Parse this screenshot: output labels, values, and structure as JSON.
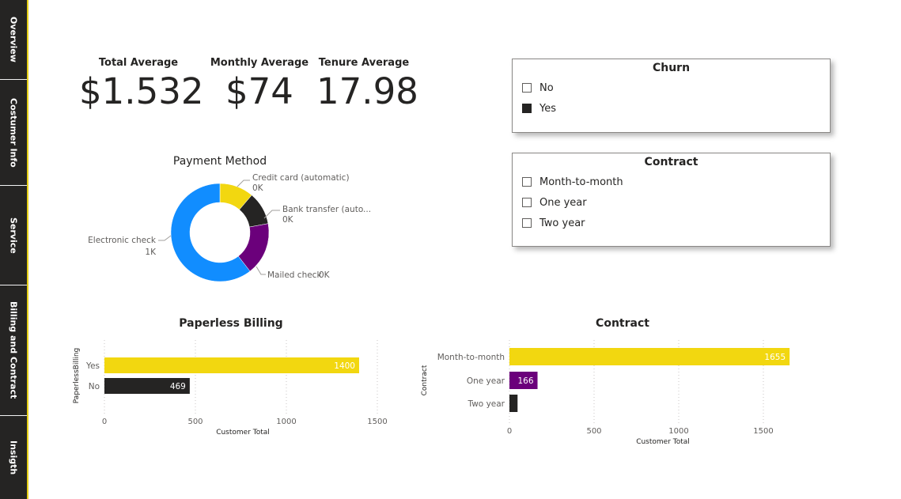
{
  "nav": {
    "tabs": [
      {
        "label": "Overview"
      },
      {
        "label": "Costumer Info"
      },
      {
        "label": "Service"
      },
      {
        "label": "Billing and Contract"
      },
      {
        "label": "Insigth"
      }
    ],
    "active_index": 3
  },
  "kpis": {
    "total_average": {
      "title": "Total Average",
      "value": "$1.532"
    },
    "monthly_average": {
      "title": "Monthly Average",
      "value": "$74"
    },
    "tenure_average": {
      "title": "Tenure Average",
      "value": "17.98"
    }
  },
  "slicers": {
    "churn": {
      "title": "Churn",
      "items": [
        {
          "label": "No",
          "checked": false
        },
        {
          "label": "Yes",
          "checked": true
        }
      ]
    },
    "contract": {
      "title": "Contract",
      "items": [
        {
          "label": "Month-to-month",
          "checked": false
        },
        {
          "label": "One year",
          "checked": false
        },
        {
          "label": "Two year",
          "checked": false
        }
      ]
    }
  },
  "chart_data": [
    {
      "id": "payment",
      "type": "pie",
      "title": "Payment Method",
      "donut": true,
      "slices": [
        {
          "label": "Credit card (automatic)",
          "value": 199,
          "data_label": "0K",
          "color": "#F2D710"
        },
        {
          "label": "Bank transfer (auto...",
          "value": 192,
          "data_label": "0K",
          "color": "#252423"
        },
        {
          "label": "Mailed check",
          "value": 308,
          "data_label": "0K",
          "color": "#6B007B"
        },
        {
          "label": "Electronic check",
          "value": 1071,
          "data_label": "1K",
          "color": "#118DFF"
        }
      ]
    },
    {
      "id": "paperless",
      "type": "bar",
      "orientation": "horizontal",
      "title": "Paperless Billing",
      "xlabel": "Customer Total",
      "ylabel": "PaperlessBilling",
      "categories": [
        "Yes",
        "No"
      ],
      "values": [
        1400,
        469
      ],
      "data_labels": [
        "1400",
        "469"
      ],
      "colors": [
        "#F2D710",
        "#252423"
      ],
      "xlim": [
        0,
        1500
      ],
      "xticks": [
        0,
        500,
        1000,
        1500
      ],
      "grid": true
    },
    {
      "id": "contract",
      "type": "bar",
      "orientation": "horizontal",
      "title": "Contract",
      "xlabel": "Customer Total",
      "ylabel": "Contract",
      "categories": [
        "Month-to-month",
        "One year",
        "Two year"
      ],
      "values": [
        1655,
        166,
        48
      ],
      "data_labels": [
        "1655",
        "166",
        ""
      ],
      "colors": [
        "#F2D710",
        "#6B007B",
        "#252423"
      ],
      "xlim": [
        0,
        1500
      ],
      "xticks": [
        0,
        500,
        1000,
        1500
      ],
      "grid": true
    }
  ]
}
